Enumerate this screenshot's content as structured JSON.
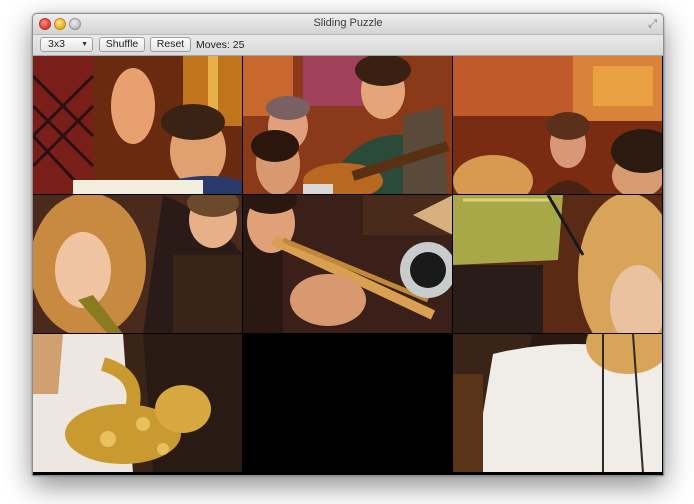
{
  "window": {
    "title": "Sliding Puzzle"
  },
  "toolbar": {
    "size_selected": "3x3",
    "shuffle_label": "Shuffle",
    "reset_label": "Reset",
    "moves_text": "Moves: 25"
  },
  "puzzle": {
    "grid": "3x3",
    "empty_position": "row 3, column 2"
  },
  "colors": {
    "close": "#e0443a",
    "minimize": "#f5b529",
    "zoom": "#c6c6c6",
    "board_background": "#000000"
  },
  "icons": {
    "close": "close-icon",
    "minimize": "minimize-icon",
    "zoom": "zoom-icon",
    "fullscreen": "fullscreen-icon",
    "dropdown": "chevron-down-icon"
  }
}
